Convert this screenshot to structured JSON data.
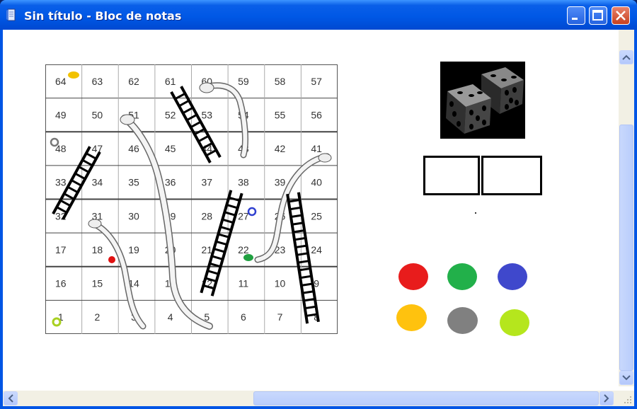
{
  "window": {
    "title": "Sin título - Bloc de notas",
    "icon": "notepad-icon",
    "controls": [
      "minimize-icon",
      "maximize-icon",
      "close-icon"
    ]
  },
  "board": {
    "cells": [
      [
        "64",
        "63",
        "62",
        "61",
        "60",
        "59",
        "58",
        "57"
      ],
      [
        "49",
        "50",
        "51",
        "52",
        "53",
        "54",
        "55",
        "56"
      ],
      [
        "48",
        "47",
        "46",
        "45",
        "44",
        "43",
        "42",
        "41"
      ],
      [
        "33",
        "34",
        "35",
        "36",
        "37",
        "38",
        "39",
        "40"
      ],
      [
        "32",
        "31",
        "30",
        "29",
        "28",
        "27",
        "26",
        "25"
      ],
      [
        "17",
        "18",
        "19",
        "20",
        "21",
        "22",
        "23",
        "24"
      ],
      [
        "16",
        "15",
        "14",
        "13",
        "12",
        "11",
        "10",
        "9"
      ],
      [
        "1",
        "2",
        "3",
        "4",
        "5",
        "6",
        "7",
        "8"
      ]
    ],
    "pieces": [
      {
        "color": "#f2c200",
        "cell": "64"
      },
      {
        "color": "#777777",
        "cell": "48"
      },
      {
        "color": "#3040d0",
        "cell": "27"
      },
      {
        "color": "#e01010",
        "cell": "18"
      },
      {
        "color": "#20a040",
        "cell": "22"
      },
      {
        "color": "#a8d020",
        "cell": "1"
      }
    ]
  },
  "dice": {
    "icon": "dice-icon",
    "boxes": [
      "",
      ""
    ]
  },
  "player_colors": [
    "#e81c1c",
    "#22b04a",
    "#3f48cc",
    "#ffc20e",
    "#808080",
    "#b5e61d"
  ]
}
